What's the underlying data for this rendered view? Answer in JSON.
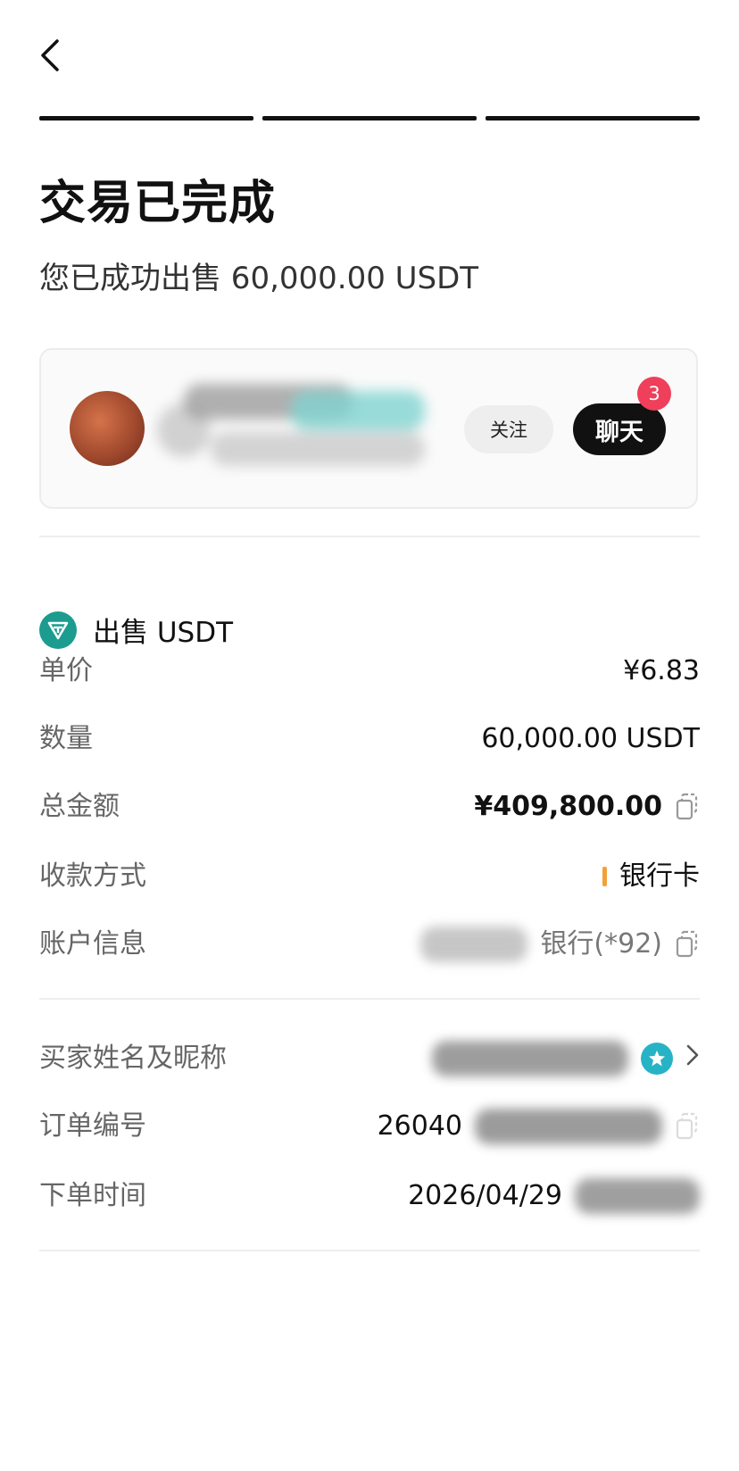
{
  "header": {
    "back_icon": "chevron-left-icon",
    "progress_steps": 3,
    "title": "交易已完成",
    "subtitle": "您已成功出售 60,000.00 USDT"
  },
  "counterparty": {
    "follow_label": "关注",
    "chat_label": "聊天",
    "chat_unread": "3"
  },
  "order": {
    "section_title": "出售 USDT",
    "rows": [
      {
        "label": "单价",
        "value": "¥6.83"
      },
      {
        "label": "数量",
        "value": "60,000.00 USDT"
      },
      {
        "label": "总金额",
        "value": "¥409,800.00"
      },
      {
        "label": "收款方式",
        "value": "银行卡"
      },
      {
        "label": "账户信息",
        "value": "银行(*92)"
      }
    ]
  },
  "details": {
    "rows": [
      {
        "label": "买家姓名及昵称",
        "value": ""
      },
      {
        "label": "订单编号",
        "value": "26040"
      },
      {
        "label": "下单时间",
        "value": "2026/04/29"
      }
    ]
  },
  "colors": {
    "accent": "#111111",
    "badge": "#ef3f5b",
    "usdt": "#1b9c8f",
    "pay_marker": "#f2a13a"
  }
}
